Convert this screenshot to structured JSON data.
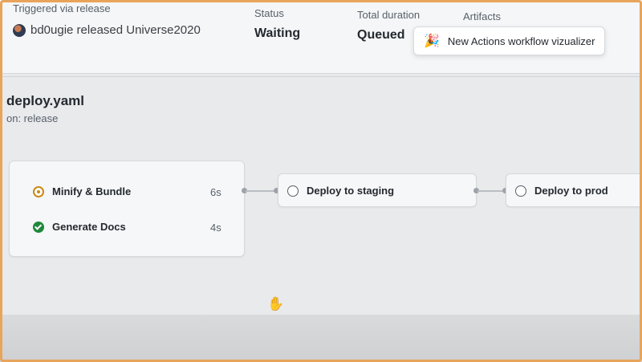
{
  "header": {
    "triggered_label": "Triggered via release",
    "trigger_text": "bd0ugie released Universe2020",
    "status_label": "Status",
    "status_value": "Waiting",
    "duration_label": "Total duration",
    "duration_value": "Queued",
    "artifacts_label": "Artifacts"
  },
  "toast": {
    "icon": "party-popper-icon",
    "text": "New Actions workflow vizualizer"
  },
  "workflow": {
    "title": "deploy.yaml",
    "subtitle": "on: release"
  },
  "jobs_group": [
    {
      "name": "Minify & Bundle",
      "duration": "6s",
      "status": "in_progress"
    },
    {
      "name": "Generate Docs",
      "duration": "4s",
      "status": "success"
    }
  ],
  "stages": [
    {
      "name": "Deploy to staging",
      "status": "queued"
    },
    {
      "name": "Deploy to prod",
      "status": "queued"
    }
  ],
  "colors": {
    "accent_pending": "#c98a16",
    "success": "#1f883d",
    "frame": "#e8a45a"
  }
}
